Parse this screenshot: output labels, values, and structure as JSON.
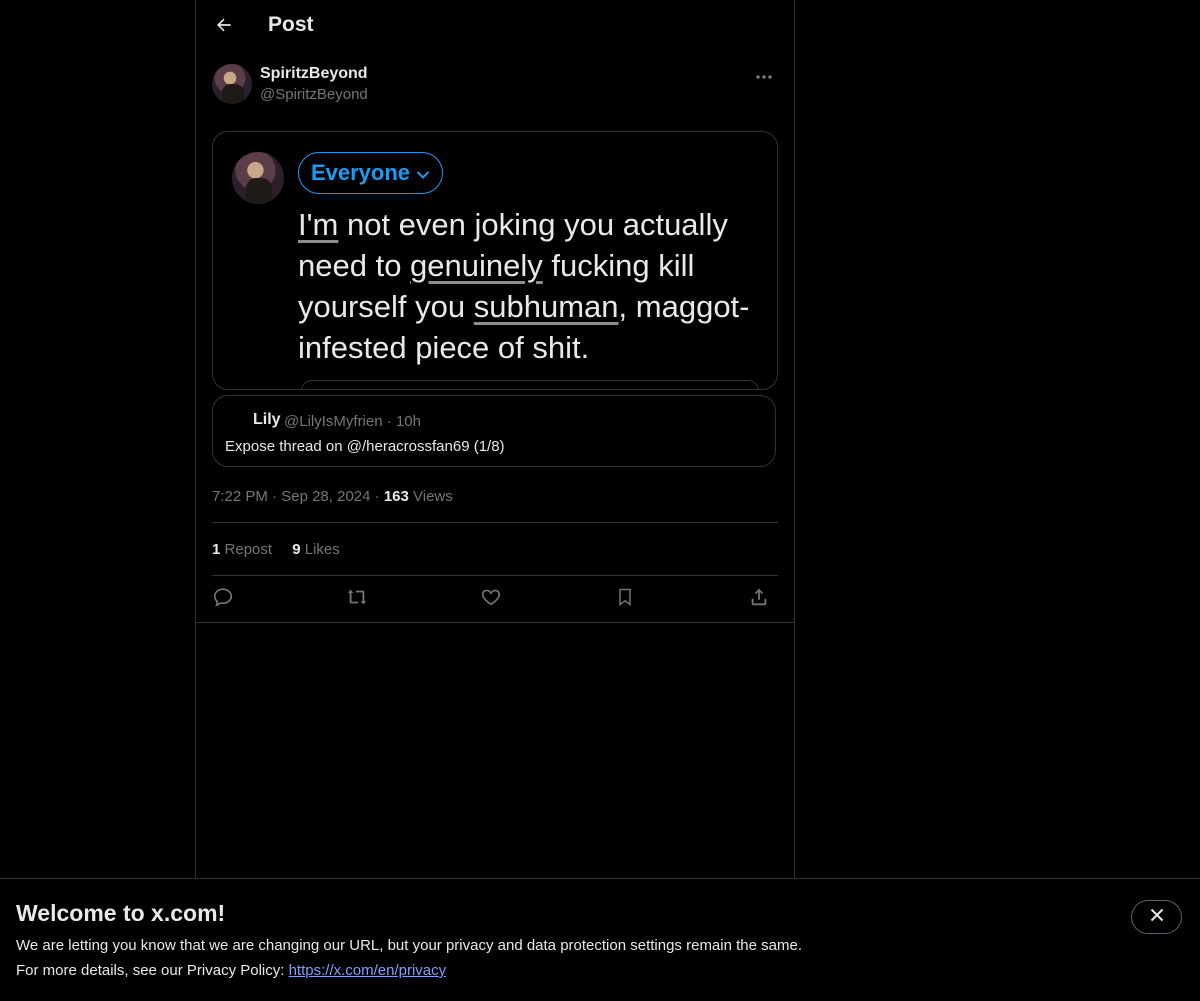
{
  "header": {
    "title": "Post",
    "back_icon": "arrow-left-icon"
  },
  "post": {
    "author_name": "SpiritzBeyond",
    "author_handle": "@SpiritzBeyond",
    "more_icon": "more-horizontal-icon",
    "media": {
      "audience_label": "Everyone",
      "text_parts": [
        {
          "t": "I'm",
          "u": true
        },
        {
          "t": " not even joking you actually need to ",
          "u": false
        },
        {
          "t": "genuinely",
          "u": true
        },
        {
          "t": " fucking kill yourself you ",
          "u": false
        },
        {
          "t": "subhuman",
          "u": true
        },
        {
          "t": ", maggot-infested piece of shit.",
          "u": false
        }
      ]
    },
    "quote": {
      "name": "Lily",
      "handle": "@LilyIsMyfrien",
      "sep": "·",
      "time": "10h",
      "text": "Expose thread on @/heracrossfan69 (1/8)"
    },
    "time": "7:22 PM",
    "date": "Sep 28, 2024",
    "sep": "·",
    "views_count": "163",
    "views_label": "Views",
    "reposts_count": "1",
    "reposts_label": "Repost",
    "likes_count": "9",
    "likes_label": "Likes"
  },
  "actions": [
    "reply-icon",
    "repost-icon",
    "like-icon",
    "bookmark-icon",
    "share-icon"
  ],
  "banner": {
    "title": "Welcome to x.com!",
    "line1": "We are letting you know that we are changing our URL, but your privacy and data protection settings remain the same.",
    "line2_prefix": "For more details, see our Privacy Policy: ",
    "link": "https://x.com/en/privacy",
    "close_icon": "close-icon"
  }
}
